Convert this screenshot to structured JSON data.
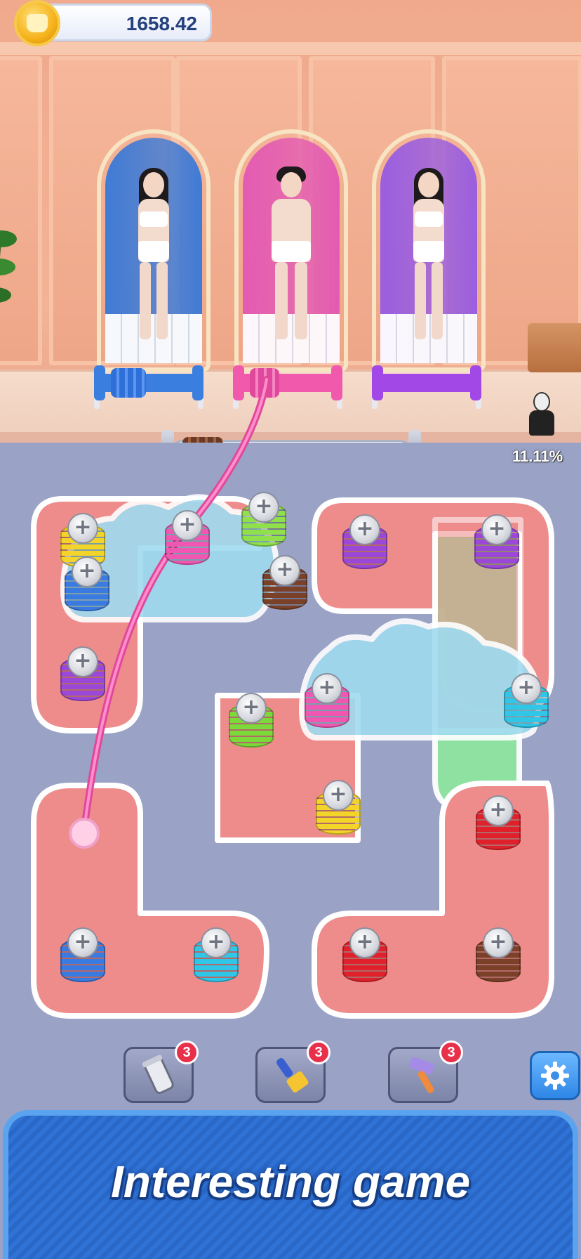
{
  "hud": {
    "coins": "1658.42",
    "progress": "11.11%"
  },
  "characters": [
    {
      "name": "character-left",
      "booth_color": "#3f7bd6",
      "spool_color": "#3a7fe0",
      "hair": "long"
    },
    {
      "name": "character-center",
      "booth_color": "#e35bb2",
      "spool_color": "#f159ad",
      "hair": "short"
    },
    {
      "name": "character-right",
      "booth_color": "#9a5ee0",
      "spool_color": "#a148e6",
      "hair": "long"
    }
  ],
  "screws": [
    {
      "color": "#f3d428",
      "label": "+"
    },
    {
      "color": "#f157b2",
      "label": "+"
    },
    {
      "color": "#8fe04a",
      "label": "+"
    },
    {
      "color": "#3a7be2",
      "label": "+"
    },
    {
      "color": "#7a4028",
      "label": "+"
    },
    {
      "color": "#9b48d8",
      "label": "+"
    },
    {
      "color": "#9b48d8",
      "label": "+"
    },
    {
      "color": "#9b48d8",
      "label": "+"
    },
    {
      "color": "#f157b2",
      "label": "+"
    },
    {
      "color": "#2fc6e8",
      "label": "+"
    },
    {
      "color": "#7cd93a",
      "label": "+"
    },
    {
      "color": "#f3d428",
      "label": "+"
    },
    {
      "color": "#e0202a",
      "label": "+"
    },
    {
      "color": "#3a7be2",
      "label": "+"
    },
    {
      "color": "#2fc6e8",
      "label": "+"
    },
    {
      "color": "#e0202a",
      "label": "+"
    },
    {
      "color": "#7a4028",
      "label": "+"
    }
  ],
  "toolbar": {
    "spool_tool_count": "3",
    "brush_tool_count": "3",
    "hammer_tool_count": "3"
  },
  "banner": {
    "text": "Interesting game"
  }
}
